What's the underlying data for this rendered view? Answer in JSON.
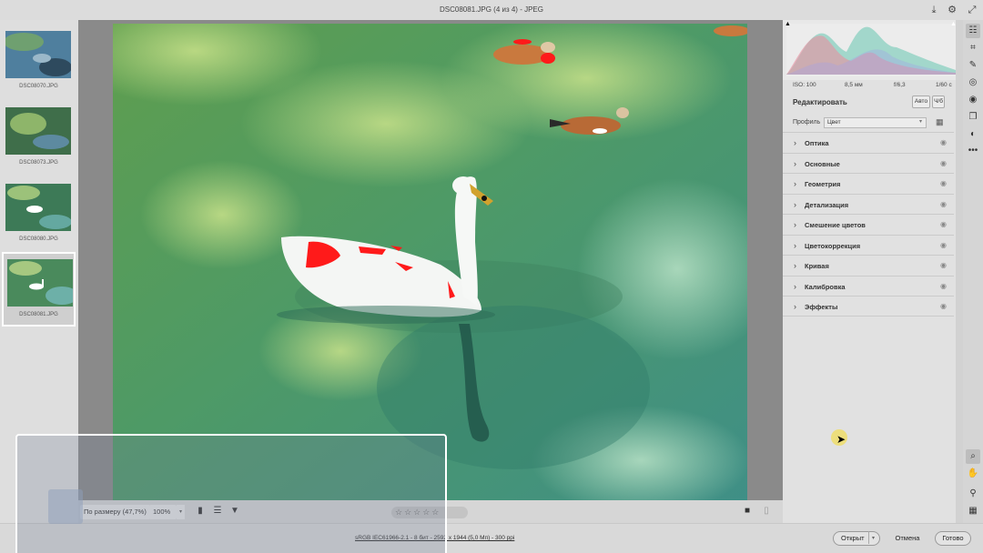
{
  "titlebar": {
    "title": "DSC08081.JPG  (4 из 4)  -  JPEG",
    "icons": [
      "save-download-icon",
      "settings-icon",
      "expand-icon"
    ]
  },
  "filmstrip": {
    "items": [
      {
        "filename": "DSC08070.JPG",
        "selected": false
      },
      {
        "filename": "DSC08073.JPG",
        "selected": false
      },
      {
        "filename": "DSC08080.JPG",
        "selected": false
      },
      {
        "filename": "DSC08081.JPG",
        "selected": true
      }
    ]
  },
  "bottombar": {
    "zoom_fit": "По размеру (47,7%)",
    "zoom_percent": "100%",
    "rating_stars": "☆☆☆☆☆",
    "icons": [
      "filmstrip-icon",
      "sort-icon",
      "filter-icon",
      "before-after-icon",
      "compare-icon"
    ]
  },
  "status": {
    "info": "sRGB IEC61966-2.1 - 8 бит - 2592 x 1944 (5,0 Мп) - 300 ppi",
    "open_label": "Открыт",
    "cancel_label": "Отмена",
    "done_label": "Готово"
  },
  "panel": {
    "exif": {
      "iso": "ISO: 100",
      "focal": "8,5 мм",
      "aperture": "f/6,3",
      "shutter": "1/60 с"
    },
    "edit_title": "Редактировать",
    "auto_label": "Авто",
    "bw_label": "Ч/б",
    "profile_label": "Профиль",
    "profile_value": "Цвет",
    "sections": [
      {
        "label": "Оптика"
      },
      {
        "label": "Основные"
      },
      {
        "label": "Геометрия"
      },
      {
        "label": "Детализация"
      },
      {
        "label": "Смешение цветов"
      },
      {
        "label": "Цветокоррекция"
      },
      {
        "label": "Кривая"
      },
      {
        "label": "Калибровка"
      },
      {
        "label": "Эффекты"
      }
    ]
  },
  "tools": [
    "edit-sliders-icon",
    "crop-icon",
    "healing-brush-icon",
    "mask-icon",
    "red-eye-icon",
    "snapshots-icon",
    "presets-icon",
    "more-icon",
    "zoom-icon",
    "hand-icon",
    "color-sampler-icon",
    "grid-icon"
  ],
  "colors": {
    "accent_white": "#ffffff",
    "water_green": "#5a9a5e",
    "clipping_red": "#ff1a1a"
  }
}
